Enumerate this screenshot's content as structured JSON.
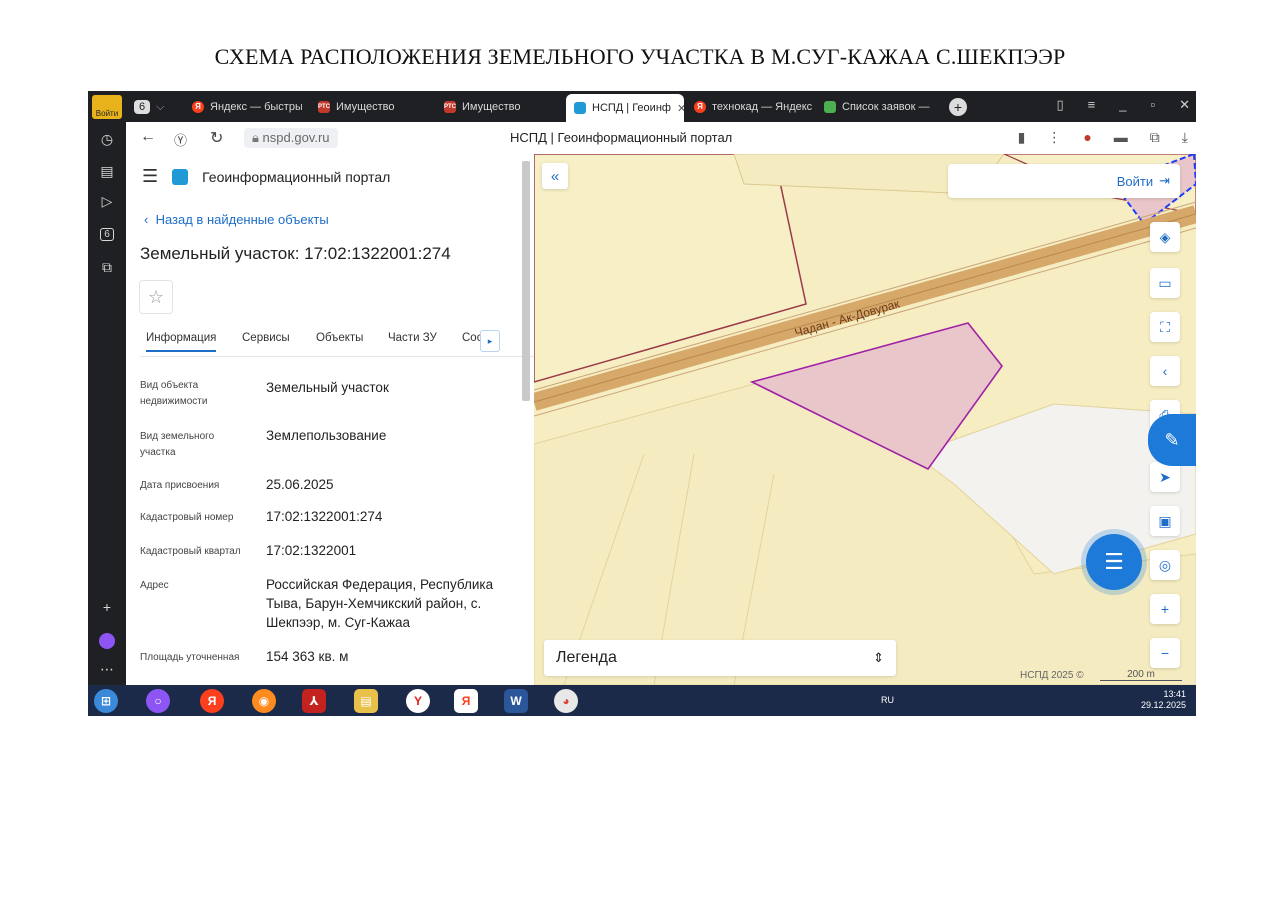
{
  "document": {
    "title": "СХЕМА РАСПОЛОЖЕНИЯ ЗЕМЕЛЬНОГО УЧАСТКА В М.СУГ-КАЖАА С.ШЕКПЭЭР"
  },
  "browser": {
    "login_badge": "Войти",
    "tab_counter": "6",
    "tabs": [
      {
        "label": "Яндекс — быстрый",
        "icon": "yandex-icon"
      },
      {
        "label": "Имущество",
        "icon": "rts-icon"
      },
      {
        "label": "Имущество",
        "icon": "rts-icon"
      },
      {
        "label": "НСПД | Геоинф",
        "icon": "nspd-icon",
        "active": true
      },
      {
        "label": "технокад — Яндекс",
        "icon": "yandex-icon"
      },
      {
        "label": "Список заявок —",
        "icon": "list-icon"
      }
    ],
    "url": "nspd.gov.ru",
    "page_title": "НСПД | Геоинформационный портал"
  },
  "panel": {
    "portal_name": "Геоинформационный портал",
    "back_link": "Назад в найденные объекты",
    "object_title": "Земельный участок: 17:02:1322001:274",
    "tabs": [
      "Информация",
      "Сервисы",
      "Объекты",
      "Части ЗУ",
      "Соста"
    ],
    "rows": [
      {
        "label": "Вид объекта недвижимости",
        "value": "Земельный участок"
      },
      {
        "label": "Вид земельного участка",
        "value": "Землепользование"
      },
      {
        "label": "Дата присвоения",
        "value": "25.06.2025"
      },
      {
        "label": "Кадастровый номер",
        "value": "17:02:1322001:274"
      },
      {
        "label": "Кадастровый квартал",
        "value": "17:02:1322001"
      },
      {
        "label": "Адрес",
        "value": "Российская Федерация, Республика Тыва, Барун-Хемчикский район, с. Шекпээр, м. Суг-Кажаа"
      },
      {
        "label": "Площадь уточненная",
        "value": "154 363 кв. м"
      }
    ]
  },
  "map": {
    "login_label": "Войти",
    "street_label": "Чадан - Ак-Довурак",
    "legend_label": "Легенда",
    "attribution": "НСПД 2025 ©",
    "scale_label": "200 m",
    "colors": {
      "land": "#f6eec2",
      "road": "#d6a86a",
      "parcel_fill": "#e9c6c9",
      "parcel_stroke": "#a020a8",
      "boundary": "#9b3a4a",
      "accent": "#1e7ad9"
    }
  },
  "taskbar": {
    "lang": "RU",
    "time": "13:41",
    "date": "29.12.2025"
  }
}
